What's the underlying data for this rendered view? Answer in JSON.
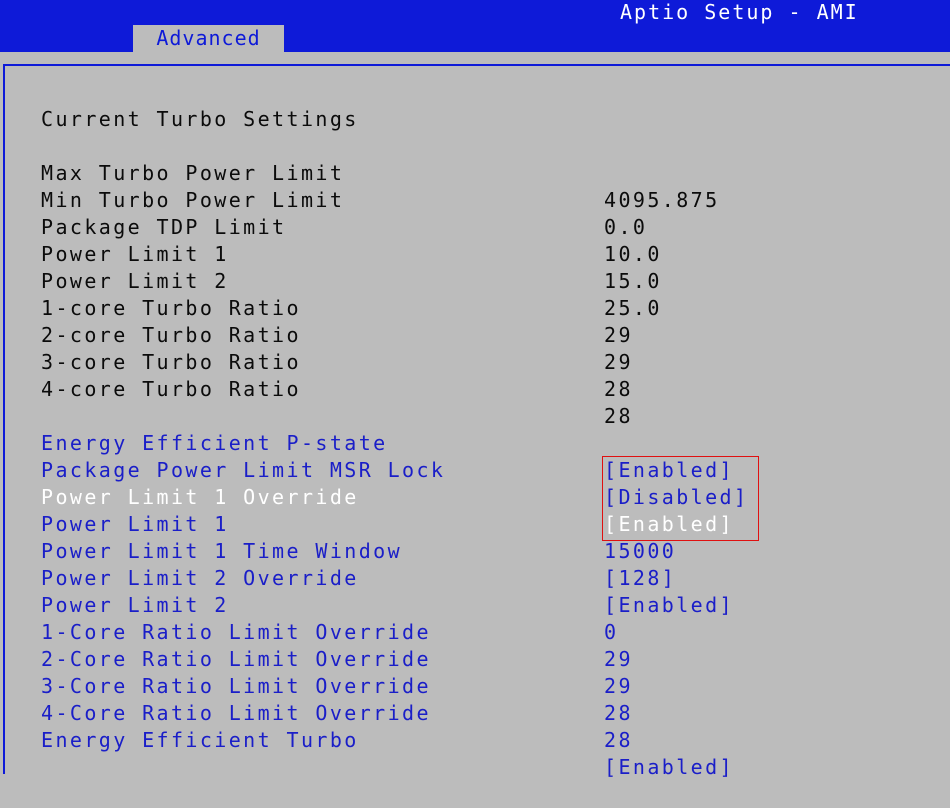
{
  "header": {
    "app_title": "Aptio Setup - AMI",
    "active_tab": "Advanced"
  },
  "section_title": "Current Turbo Settings",
  "info_rows": [
    {
      "label": "Max Turbo Power Limit",
      "value": "4095.875"
    },
    {
      "label": "Min Turbo Power Limit",
      "value": "0.0"
    },
    {
      "label": "Package TDP Limit",
      "value": "10.0"
    },
    {
      "label": "Power Limit 1",
      "value": "15.0"
    },
    {
      "label": "Power Limit 2",
      "value": "25.0"
    },
    {
      "label": "1-core Turbo Ratio",
      "value": "29"
    },
    {
      "label": "2-core Turbo Ratio",
      "value": "29"
    },
    {
      "label": "3-core Turbo Ratio",
      "value": "28"
    },
    {
      "label": "4-core Turbo Ratio",
      "value": "28"
    }
  ],
  "option_rows": [
    {
      "label": "Energy Efficient P-state",
      "value": "[Enabled]"
    },
    {
      "label": "Package Power Limit MSR Lock",
      "value": "[Disabled]"
    },
    {
      "label": "Power Limit 1 Override",
      "value": "[Enabled]"
    },
    {
      "label": "Power Limit 1",
      "value": "15000"
    },
    {
      "label": "Power Limit 1 Time Window",
      "value": "[128]"
    },
    {
      "label": "Power Limit 2 Override",
      "value": "[Enabled]"
    },
    {
      "label": "Power Limit 2",
      "value": "0"
    },
    {
      "label": "1-Core Ratio Limit Override",
      "value": "29"
    },
    {
      "label": "2-Core Ratio Limit Override",
      "value": "29"
    },
    {
      "label": "3-Core Ratio Limit Override",
      "value": "28"
    },
    {
      "label": "4-Core Ratio Limit Override",
      "value": "28"
    },
    {
      "label": "Energy Efficient Turbo",
      "value": "[Enabled]"
    }
  ],
  "colors": {
    "header_blue": "#0e1ad8",
    "background_gray": "#bcbcbc",
    "option_text": "#1a1ec8",
    "selected_text": "#ffffff",
    "annotation_red": "#e01010"
  }
}
